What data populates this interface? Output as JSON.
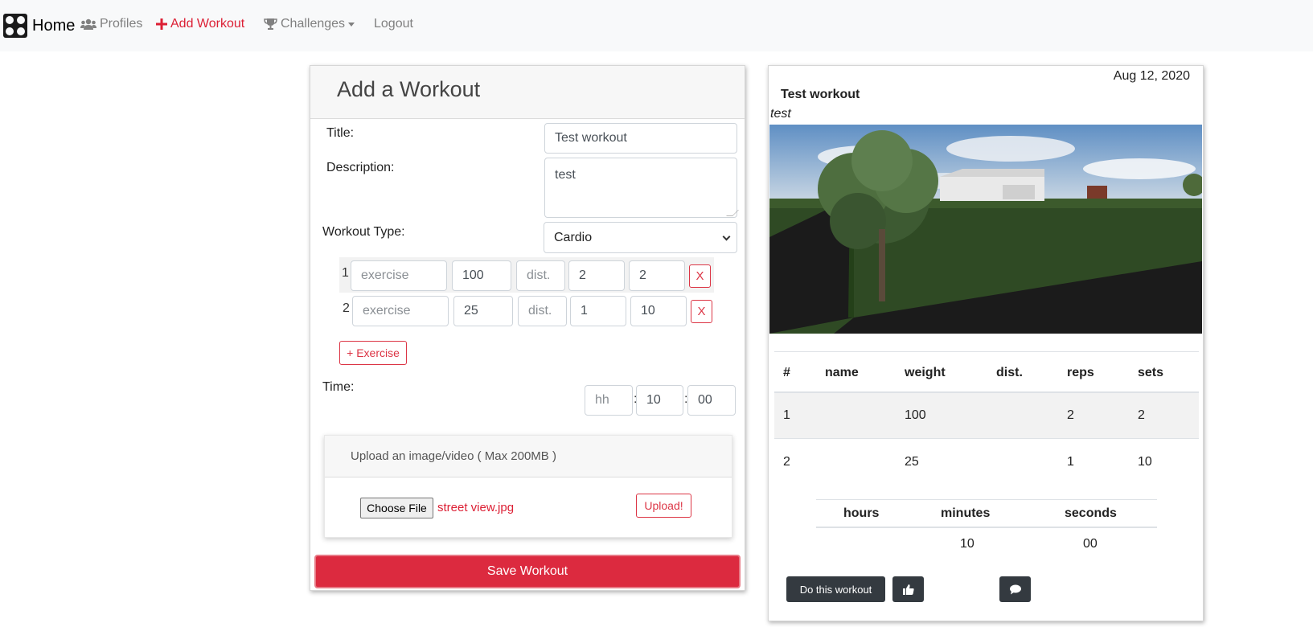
{
  "navbar": {
    "brand": "Home",
    "links": [
      {
        "label": "Profiles",
        "icon": "users-icon"
      },
      {
        "label": "Add Workout",
        "icon": "plus-icon",
        "active": true
      },
      {
        "label": "Challenges",
        "icon": "trophy-icon",
        "dropdown": true
      },
      {
        "label": "Logout"
      }
    ]
  },
  "form": {
    "header": "Add a Workout",
    "title_label": "Title:",
    "title_value": "Test workout",
    "description_label": "Description:",
    "description_value": "test",
    "type_label": "Workout Type:",
    "type_value": "Cardio",
    "exercises": [
      {
        "num": "1",
        "name_placeholder": "exercise",
        "weight": "100",
        "dist_placeholder": "dist.",
        "reps": "2",
        "sets": "2",
        "remove": "X"
      },
      {
        "num": "2",
        "name_placeholder": "exercise",
        "weight": "25",
        "dist_placeholder": "dist.",
        "reps": "1",
        "sets": "10",
        "remove": "X"
      }
    ],
    "add_exercise": "+ Exercise",
    "time_label": "Time:",
    "time": {
      "hours_placeholder": "hh",
      "minutes": "10",
      "seconds": "00",
      "sep": ":"
    },
    "upload": {
      "title": "Upload an image/video ( Max 200MB )",
      "choose": "Choose File",
      "file": "street view.jpg",
      "button": "Upload!"
    },
    "save": "Save Workout"
  },
  "post": {
    "date": "Aug 12, 2020",
    "title": "Test workout",
    "description": "test",
    "table": {
      "headers": [
        "#",
        "name",
        "weight",
        "dist.",
        "reps",
        "sets"
      ],
      "rows": [
        [
          "1",
          "",
          "100",
          "",
          "2",
          "2"
        ],
        [
          "2",
          "",
          "25",
          "",
          "1",
          "10"
        ]
      ]
    },
    "time_table": {
      "headers": [
        "hours",
        "minutes",
        "seconds"
      ],
      "values": [
        "",
        "10",
        "00"
      ]
    },
    "do_workout": "Do this workout"
  },
  "colors": {
    "accent": "#dc3545",
    "navbar_bg": "#f8f9fa",
    "dark_button": "#343a40"
  }
}
